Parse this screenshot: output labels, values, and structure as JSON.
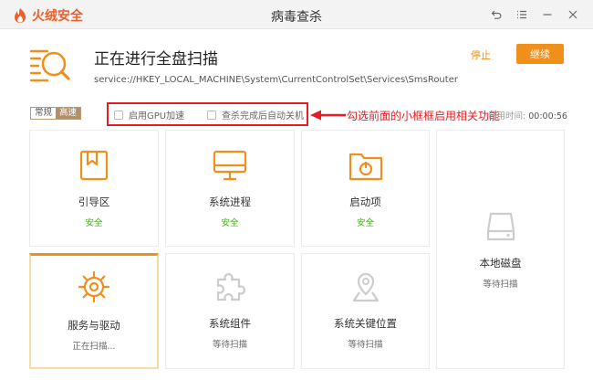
{
  "app": {
    "name": "火绒安全",
    "window_title": "病毒查杀"
  },
  "colors": {
    "brand": "#e8612c",
    "accent": "#f0901a",
    "safe": "#42a61a",
    "annotation": "#e51c23"
  },
  "scan": {
    "title": "正在进行全盘扫描",
    "path": "service://HKEY_LOCAL_MACHINE\\System\\CurrentControlSet\\Services\\SmsRouter",
    "stop_label": "停止",
    "continue_label": "继续"
  },
  "mode": {
    "normal_label": "常规",
    "fast_label": "高速",
    "selected": "高速"
  },
  "options": {
    "gpu_label": "启用GPU加速",
    "shutdown_label": "查杀完成后自动关机"
  },
  "annotation": {
    "text": "勾选前面的小框框启用相关功能"
  },
  "elapsed": {
    "label": "已用时间:",
    "value": "00:00:56"
  },
  "tiles": [
    {
      "name": "引导区",
      "status": "安全",
      "icon": "boot-icon"
    },
    {
      "name": "系统进程",
      "status": "安全",
      "icon": "monitor-icon"
    },
    {
      "name": "启动项",
      "status": "安全",
      "icon": "startup-icon"
    },
    {
      "name": "本地磁盘",
      "status": "等待扫描",
      "icon": "disk-icon"
    },
    {
      "name": "服务与驱动",
      "status": "正在扫描...",
      "icon": "gear-icon"
    },
    {
      "name": "系统组件",
      "status": "等待扫描",
      "icon": "puzzle-icon"
    },
    {
      "name": "系统关键位置",
      "status": "等待扫描",
      "icon": "location-icon"
    }
  ]
}
